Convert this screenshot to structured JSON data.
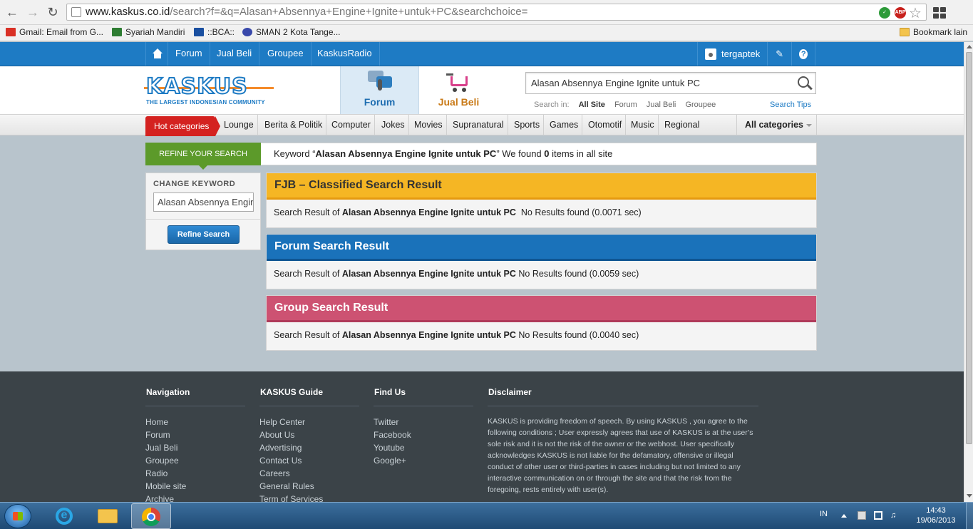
{
  "browser": {
    "url_domain": "www.kaskus.co.id",
    "url_path": "/search?f=&q=Alasan+Absennya+Engine+Ignite+untuk+PC&searchchoice=",
    "bookmarks": [
      {
        "label": "Gmail: Email from G...",
        "color": "#d93025"
      },
      {
        "label": "Syariah Mandiri",
        "color": "#2e7d32"
      },
      {
        "label": "::BCA::",
        "color": "#1a4fa0"
      },
      {
        "label": "SMAN 2 Kota Tange...",
        "color": "#3949ab"
      }
    ],
    "bookmark_other": "Bookmark lain"
  },
  "topnav": {
    "items": [
      "Forum",
      "Jual Beli",
      "Groupee",
      "KaskusRadio"
    ],
    "username": "tergaptek"
  },
  "header": {
    "logo_text": "KASKUS",
    "logo_tagline": "THE LARGEST INDONESIAN COMMUNITY",
    "tab_forum": "Forum",
    "tab_jualbeli": "Jual Beli",
    "search_value": "Alasan Absennya Engine Ignite untuk PC",
    "search_in_label": "Search in:",
    "search_in_options": [
      "All Site",
      "Forum",
      "Jual Beli",
      "Groupee"
    ],
    "search_tips": "Search Tips"
  },
  "categories": {
    "hot": "Hot categories",
    "items": [
      "Lounge",
      "Berita & Politik",
      "Computer",
      "Jokes",
      "Movies",
      "Supranatural",
      "Sports",
      "Games",
      "Otomotif",
      "Music",
      "Regional"
    ],
    "all": "All categories"
  },
  "refine": {
    "label": "REFINE YOUR SEARCH",
    "keyword_prefix": "Keyword “",
    "keyword": "Alasan Absennya Engine Ignite untuk PC",
    "keyword_suffix": "” We found ",
    "count": "0",
    "count_suffix": " items in all site"
  },
  "change_keyword": {
    "title": "CHANGE KEYWORD",
    "input_value": "Alasan Absennya Engine Ignite untuk PC",
    "button": "Refine Search"
  },
  "results": [
    {
      "title": "FJB – Classified Search Result",
      "prefix": "Search Result of ",
      "keyword": "Alasan Absennya Engine Ignite untuk PC",
      "status": "  No Results found (0.0071 sec)"
    },
    {
      "title": "Forum Search Result",
      "prefix": "Search Result of ",
      "keyword": "Alasan Absennya Engine Ignite untuk PC",
      "status": " No Results found (0.0059 sec)"
    },
    {
      "title": "Group Search Result",
      "prefix": "Search Result of ",
      "keyword": "Alasan Absennya Engine Ignite untuk PC",
      "status": " No Results found (0.0040 sec)"
    }
  ],
  "footer": {
    "navigation": {
      "title": "Navigation",
      "items": [
        "Home",
        "Forum",
        "Jual Beli",
        "Groupee",
        "Radio",
        "Mobile site",
        "Archive"
      ]
    },
    "guide": {
      "title": "KASKUS Guide",
      "items": [
        "Help Center",
        "About Us",
        "Advertising",
        "Contact Us",
        "Careers",
        "General Rules",
        "Term of Services"
      ]
    },
    "findus": {
      "title": "Find Us",
      "items": [
        "Twitter",
        "Facebook",
        "Youtube",
        "Google+"
      ]
    },
    "disclaimer": {
      "title": "Disclaimer",
      "text": "KASKUS is providing freedom of speech. By using KASKUS , you agree to the following conditions ; User expressly agrees that use of KASKUS is at the user’s sole risk and it is not the risk of the owner or the webhost. User specifically acknowledges KASKUS is not liable for the defamatory, offensive or illegal conduct of other user or third-parties in cases including but not limited to any interactive communication on or through the site and that the risk from the foregoing, rests entirely with user(s)."
    }
  },
  "taskbar": {
    "lang": "IN",
    "time": "14:43",
    "date": "19/06/2013"
  }
}
